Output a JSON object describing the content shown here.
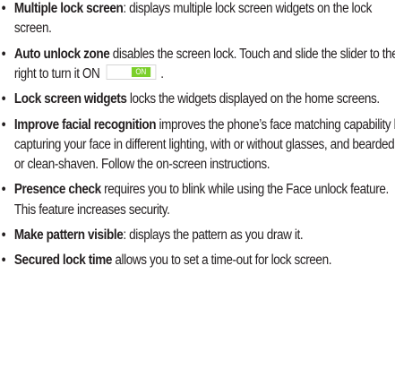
{
  "bullet_char": "•",
  "items": [
    {
      "term": "Multiple lock screen",
      "sep": ":",
      "text": " displays multiple lock screen widgets on the lock screen."
    },
    {
      "term": "Auto unlock zone",
      "sep": "",
      "text": " disables the screen lock. Touch and slide the slider to the right to turn it ON",
      "toggle_label": "ON",
      "after": " ."
    },
    {
      "term": "Lock screen widgets",
      "sep": "",
      "text": " locks the widgets displayed on the home screens."
    },
    {
      "term": "Improve facial recognition",
      "sep": "",
      "text": " improves the phone’s face matching capability by capturing your face in different lighting, with or without glasses, and bearded or clean-shaven. Follow the on-screen instructions."
    },
    {
      "term": "Presence check",
      "sep": "",
      "text": " requires you to blink while using the Face unlock feature. This feature increases security."
    },
    {
      "term": "Make pattern visible",
      "sep": ":",
      "text": " displays the pattern as you draw it."
    },
    {
      "term": "Secured lock time",
      "sep": "",
      "text": " allows you to set a time-out for lock screen."
    }
  ],
  "colors": {
    "text": "#231f20",
    "toggle_on": "#7bcf2a",
    "toggle_border": "#d6d6d6"
  }
}
